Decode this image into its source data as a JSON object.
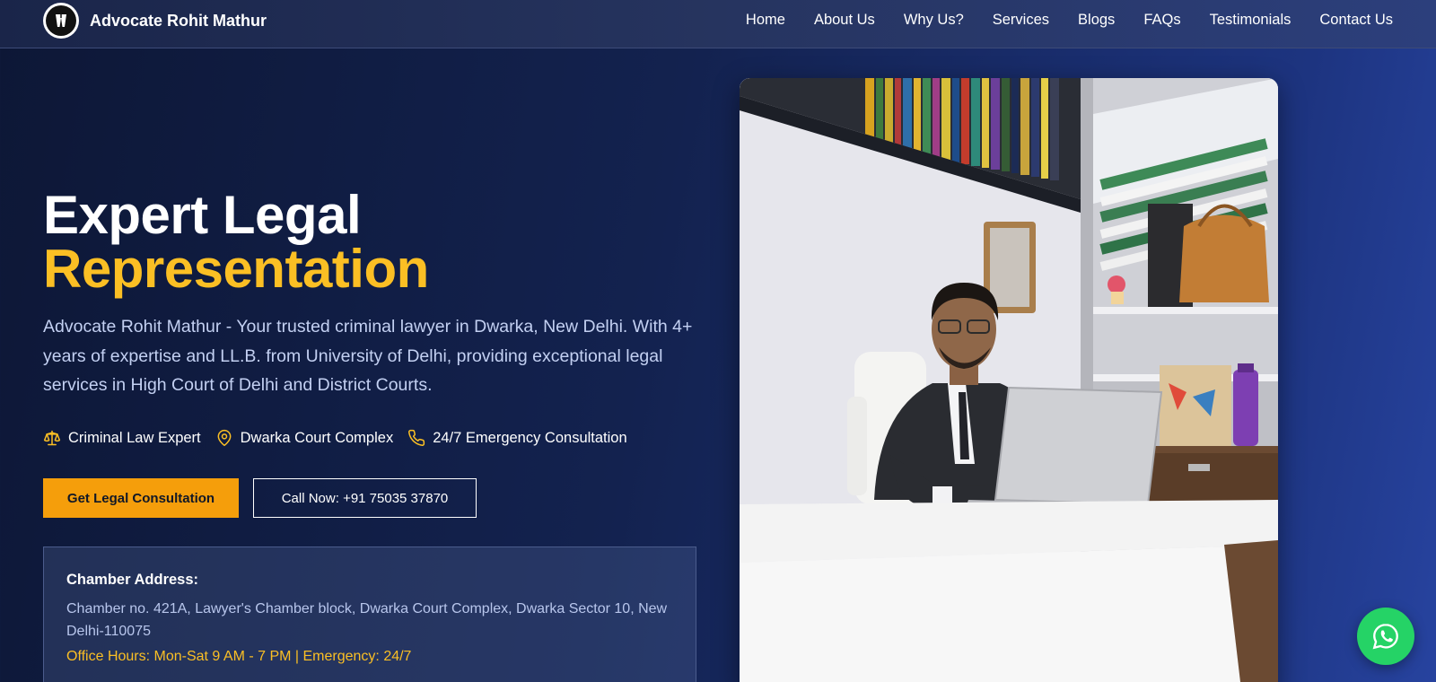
{
  "brand": {
    "name": "Advocate Rohit Mathur",
    "logo_icon": "lawyer-band-icon"
  },
  "nav": {
    "items": [
      "Home",
      "About Us",
      "Why Us?",
      "Services",
      "Blogs",
      "FAQs",
      "Testimonials",
      "Contact Us"
    ]
  },
  "hero": {
    "title_line1": "Expert Legal",
    "title_line2": "Representation",
    "description": "Advocate Rohit Mathur - Your trusted criminal lawyer in Dwarka, New Delhi. With 4+ years of expertise and LL.B. from University of Delhi, providing exceptional legal services in High Court of Delhi and District Courts.",
    "features": [
      {
        "icon": "scales-icon",
        "label": "Criminal Law Expert"
      },
      {
        "icon": "map-pin-icon",
        "label": "Dwarka Court Complex"
      },
      {
        "icon": "phone-icon",
        "label": "24/7 Emergency Consultation"
      }
    ],
    "cta_primary": "Get Legal Consultation",
    "cta_secondary": "Call Now: +91 75035 37870"
  },
  "address": {
    "title": "Chamber Address:",
    "text": "Chamber no. 421A, Lawyer's Chamber block, Dwarka Court Complex, Dwarka Sector 10, New Delhi-110075",
    "hours": "Office Hours: Mon-Sat 9 AM - 7 PM | Emergency: 24/7"
  },
  "floating": {
    "icon": "whatsapp-icon"
  },
  "colors": {
    "accent": "#fbbf24",
    "button": "#f59e0b",
    "bg_dark": "#0d1736",
    "bg_blue": "#27439f",
    "text_muted": "#c3d0f2",
    "whatsapp": "#25d366"
  }
}
